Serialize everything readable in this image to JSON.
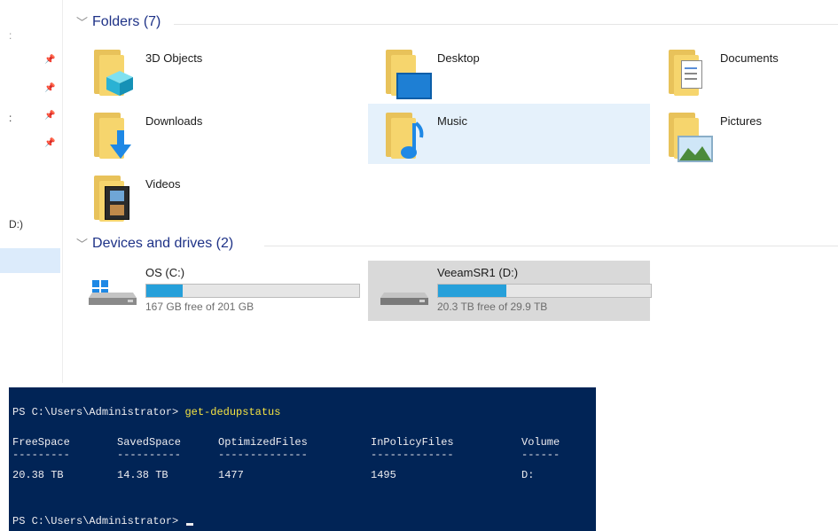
{
  "explorer": {
    "nav": {
      "fragments": [
        ":",
        ":",
        "D:)"
      ]
    },
    "folders_header": "Folders (7)",
    "folders": [
      {
        "label": "3D Objects",
        "icon": "3d-objects-folder-icon"
      },
      {
        "label": "Desktop",
        "icon": "desktop-folder-icon"
      },
      {
        "label": "Documents",
        "icon": "documents-folder-icon"
      },
      {
        "label": "Downloads",
        "icon": "downloads-folder-icon"
      },
      {
        "label": "Music",
        "icon": "music-folder-icon"
      },
      {
        "label": "Pictures",
        "icon": "pictures-folder-icon"
      },
      {
        "label": "Videos",
        "icon": "videos-folder-icon"
      }
    ],
    "drives_header": "Devices and drives (2)",
    "drives": [
      {
        "label": "OS (C:)",
        "free": "167 GB free of 201 GB",
        "used_fraction": 0.17
      },
      {
        "label": "VeeamSR1 (D:)",
        "free": "20.3 TB free of 29.9 TB",
        "used_fraction": 0.32
      }
    ]
  },
  "terminal": {
    "prompt1": "PS C:\\Users\\Administrator> ",
    "command": "get-dedupstatus",
    "headers": [
      "FreeSpace",
      "SavedSpace",
      "OptimizedFiles",
      "InPolicyFiles",
      "Volume"
    ],
    "underlines": [
      "---------",
      "----------",
      "--------------",
      "-------------",
      "------"
    ],
    "row": [
      "20.38 TB",
      "14.38 TB",
      "1477",
      "1495",
      "D:"
    ],
    "prompt2": "PS C:\\Users\\Administrator> "
  },
  "colors": {
    "accent": "#26a0da",
    "terminal_bg": "#012456",
    "command": "#f5e342"
  }
}
